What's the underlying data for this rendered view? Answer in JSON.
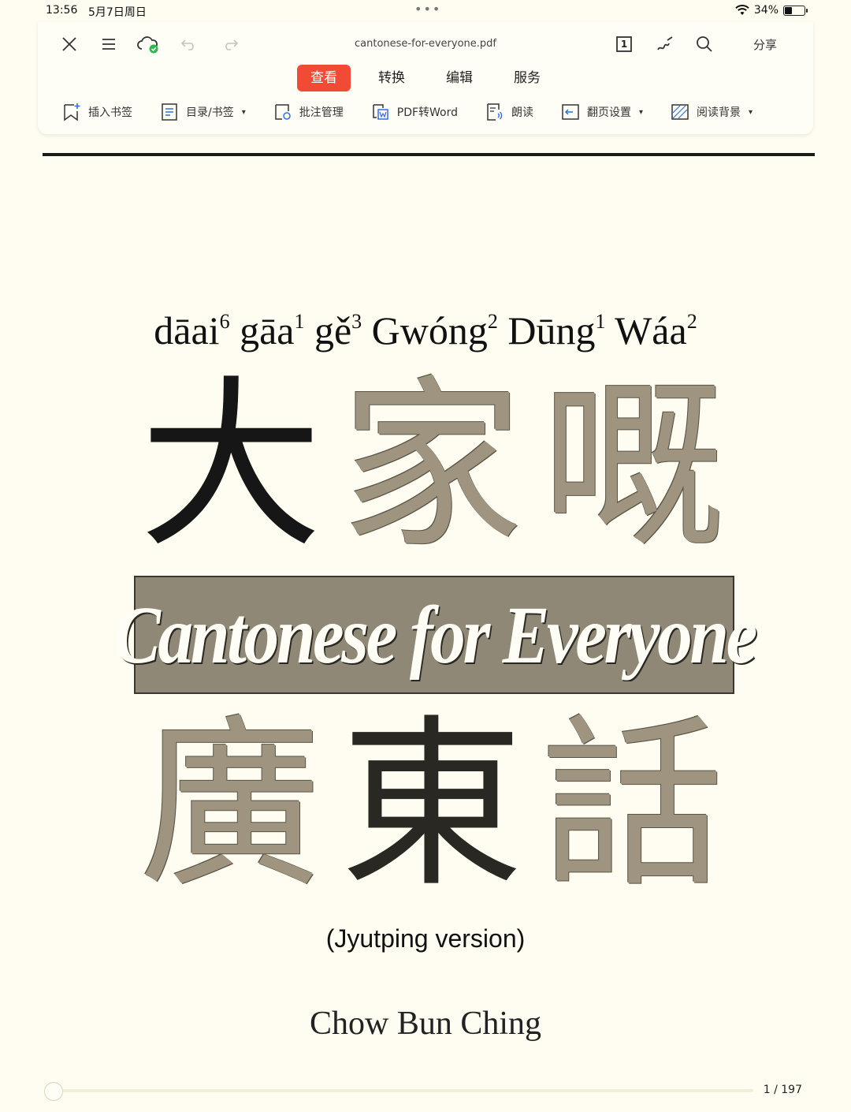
{
  "status_bar": {
    "time": "13:56",
    "date": "5月7日周日",
    "battery": "34%",
    "battery_level": 0.34
  },
  "header": {
    "filename": "cantonese-for-everyone.pdf",
    "share_label": "分享",
    "page_button": "1"
  },
  "tabs": [
    {
      "label": "查看",
      "active": true
    },
    {
      "label": "转换",
      "active": false
    },
    {
      "label": "编辑",
      "active": false
    },
    {
      "label": "服务",
      "active": false
    }
  ],
  "tools": [
    {
      "label": "插入书签",
      "icon": "bookmark-add-icon",
      "dropdown": false
    },
    {
      "label": "目录/书签",
      "icon": "toc-icon",
      "dropdown": true
    },
    {
      "label": "批注管理",
      "icon": "annotation-icon",
      "dropdown": false
    },
    {
      "label": "PDF转Word",
      "icon": "pdf-to-word-icon",
      "dropdown": false
    },
    {
      "label": "朗读",
      "icon": "read-aloud-icon",
      "dropdown": false
    },
    {
      "label": "翻页设置",
      "icon": "page-turn-icon",
      "dropdown": true
    },
    {
      "label": "阅读背景",
      "icon": "reading-background-icon",
      "dropdown": true
    }
  ],
  "document": {
    "romanization": [
      {
        "syl": "dāai",
        "tone": "6"
      },
      {
        "syl": "gāa",
        "tone": "1"
      },
      {
        "syl": "gě",
        "tone": "3"
      },
      {
        "syl": "Gwóng",
        "tone": "2"
      },
      {
        "syl": "Dūng",
        "tone": "1"
      },
      {
        "syl": "Wáa",
        "tone": "2"
      }
    ],
    "han_top": [
      "大",
      "家",
      "嘅"
    ],
    "banner": "Cantonese for Everyone",
    "han_bottom": [
      "廣",
      "東",
      "話"
    ],
    "version": "(Jyutping version)",
    "author": "Chow Bun Ching"
  },
  "footer": {
    "page_indicator": "1 / 197",
    "progress": 0.005
  },
  "colors": {
    "accent": "#f24b35",
    "paper": "#fffdf2",
    "banner_bg": "#8f8876"
  }
}
